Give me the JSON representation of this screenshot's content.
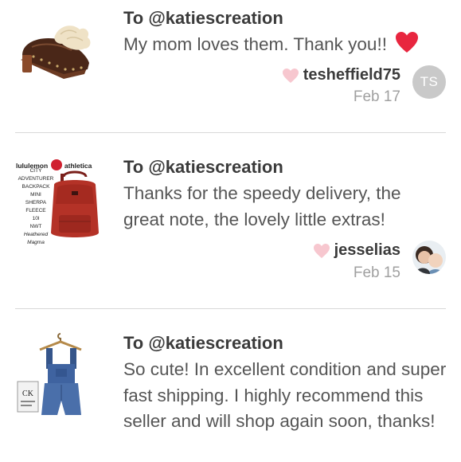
{
  "reviews": [
    {
      "to": "To @katiescreation",
      "message": "My mom loves them. Thank you!!",
      "message_emoji": "red-heart",
      "username": "tesheffield75",
      "date": "Feb 17",
      "avatar_initials": "TS",
      "thumbnail": "fur-lined-clog-image"
    },
    {
      "to": "To @katiescreation",
      "message": "Thanks for the speedy delivery, the great note, the lovely little extras!",
      "username": "jesselias",
      "date": "Feb 15",
      "avatar": "photo-avatar",
      "thumbnail": "red-backpack-image",
      "thumbnail_text": {
        "brand_left": "lululemon",
        "brand_right": "athletica",
        "lines": [
          "CITY",
          "ADVENTURER",
          "BACKPACK",
          "MINI",
          "SHERPA",
          "FLEECE",
          "10l",
          "NWT",
          "Heathered",
          "Magma"
        ]
      }
    },
    {
      "to": "To @katiescreation",
      "message": "So cute! In excellent condition and super fast shipping. I highly recommend this seller and will shop again soon, thanks!",
      "thumbnail": "denim-overalls-image"
    }
  ],
  "colors": {
    "heart_red": "#e8263f",
    "heart_pink": "#f7c7cf",
    "avatar_gray": "#c9c9c9",
    "divider": "#d9d9d9"
  }
}
